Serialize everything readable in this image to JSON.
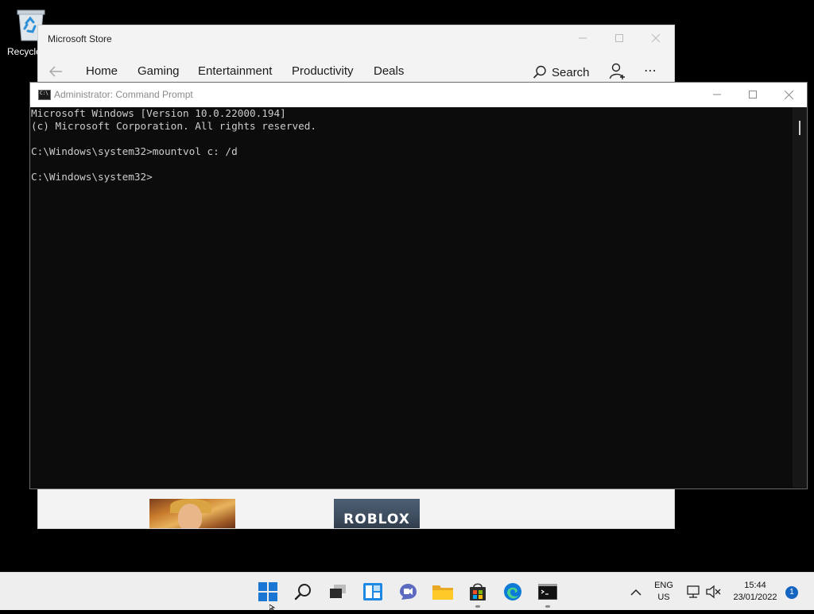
{
  "desktop": {
    "recycle_bin": {
      "label": "Recycle",
      "icon": "recycle-bin-icon"
    }
  },
  "store": {
    "title": "Microsoft Store",
    "nav_tabs": [
      {
        "label": "Home"
      },
      {
        "label": "Gaming"
      },
      {
        "label": "Entertainment"
      },
      {
        "label": "Productivity"
      },
      {
        "label": "Deals"
      }
    ],
    "search_label": "Search",
    "tiles": [
      {
        "icon": "game-artwork-tile"
      },
      {
        "name": "ROBLOX"
      }
    ]
  },
  "cmd": {
    "title": "Administrator: Command Prompt",
    "icon_text": "C:\\",
    "lines": [
      "Microsoft Windows [Version 10.0.22000.194]",
      "(c) Microsoft Corporation. All rights reserved.",
      "",
      "C:\\Windows\\system32>mountvol c: /d",
      "",
      "C:\\Windows\\system32>"
    ]
  },
  "taskbar": {
    "apps": [
      {
        "icon": "start-icon",
        "running": false
      },
      {
        "icon": "search-icon",
        "running": false
      },
      {
        "icon": "task-view-icon",
        "running": false
      },
      {
        "icon": "widgets-icon",
        "running": false
      },
      {
        "icon": "chat-icon",
        "running": false
      },
      {
        "icon": "file-explorer-icon",
        "running": false
      },
      {
        "icon": "microsoft-store-icon",
        "running": true
      },
      {
        "icon": "edge-icon",
        "running": false
      },
      {
        "icon": "command-prompt-icon",
        "running": true
      }
    ],
    "tray": {
      "lang": "ENG",
      "region": "US",
      "time": "15:44",
      "date": "23/01/2022",
      "notifications": "1"
    },
    "colors": {
      "accent": "#1976d2",
      "background": "#eeeeee"
    }
  }
}
